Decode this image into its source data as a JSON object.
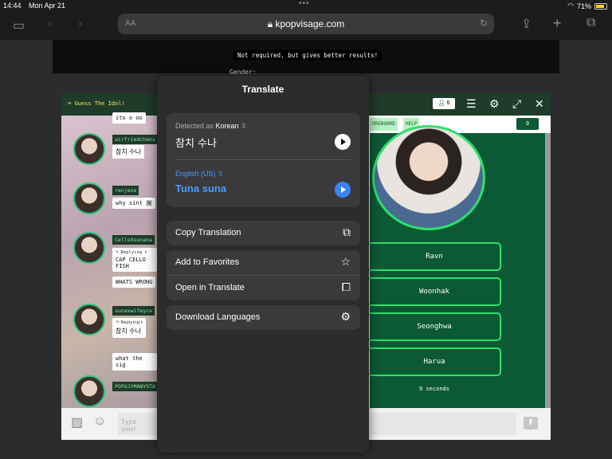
{
  "status": {
    "time": "14:44",
    "date": "Mon Apr 21",
    "battery": "71%"
  },
  "browser": {
    "url": "kpopvisage.com",
    "aa": "AA"
  },
  "page": {
    "hint": "Not required, but gives better results!",
    "gender": "Gender:"
  },
  "game": {
    "title": "Guess The Idol!",
    "players": "6",
    "chat": [
      {
        "user": "",
        "msg": "its o oo"
      },
      {
        "user": "airfriedchans",
        "msg": "참치 수나"
      },
      {
        "user": "renjene",
        "msg": "why sint",
        "tag": "N"
      },
      {
        "user": "CelloXsunana",
        "reply": "Replying t",
        "msg": "CAP CELLO FISH"
      },
      {
        "user": "",
        "msg": "WHATS WRONG"
      },
      {
        "user": "sunaxwifeyce",
        "reply": "Replying t",
        "msg": "참치 수나"
      },
      {
        "user": "",
        "msg": "what the sig"
      },
      {
        "user": "POPOJYMANYSTA",
        "msg": ""
      }
    ],
    "nav": {
      "scoreboard": "OREBOARD",
      "help": "HELP",
      "timer": "9"
    },
    "answers": [
      "Ravn",
      "Woonhak",
      "Seonghwa",
      "Harua"
    ],
    "seconds": "9 seconds",
    "input_placeholder": "Type your"
  },
  "translate": {
    "title": "Translate",
    "detected_prefix": "Detected as",
    "detected_lang": "Korean",
    "source_text": "참치 수나",
    "target_lang": "English (US)",
    "target_text": "Tuna suna",
    "actions": {
      "copy": "Copy Translation",
      "favorites": "Add to Favorites",
      "open": "Open in Translate",
      "download": "Download Languages"
    }
  }
}
